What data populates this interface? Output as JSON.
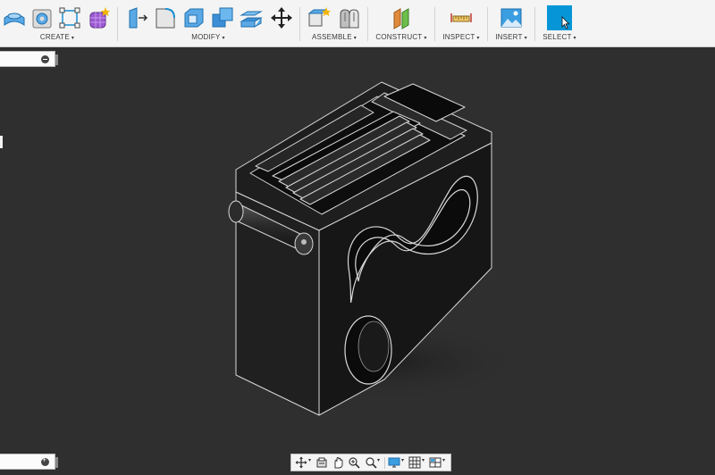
{
  "toolbar": {
    "groups": [
      {
        "id": "create",
        "label": "CREATE"
      },
      {
        "id": "modify",
        "label": "MODIFY"
      },
      {
        "id": "assemble",
        "label": "ASSEMBLE"
      },
      {
        "id": "construct",
        "label": "CONSTRUCT"
      },
      {
        "id": "inspect",
        "label": "INSPECT"
      },
      {
        "id": "insert",
        "label": "INSERT"
      },
      {
        "id": "select",
        "label": "SELECT"
      }
    ],
    "dropdown_glyph": "▾"
  },
  "icons": {
    "create": [
      "extrude-icon",
      "revolve-icon",
      "sketch-icon",
      "form-icon"
    ],
    "modify": [
      "press-pull-icon",
      "fillet-icon",
      "shell-icon",
      "combine-icon",
      "offset-face-icon",
      "move-icon"
    ],
    "assemble": [
      "new-component-icon",
      "joint-icon"
    ],
    "construct": [
      "plane-icon"
    ],
    "inspect": [
      "measure-icon"
    ],
    "insert": [
      "insert-image-icon"
    ],
    "select": [
      "select-cursor-icon"
    ]
  },
  "viewport": {
    "background": "#2f2f2f",
    "model": "3d-printed-box-with-infinity-cutout"
  },
  "panels": {
    "browser": {
      "collapse_icon": "minus-circle-icon"
    },
    "comments": {
      "expand_icon": "plus-circle-icon"
    }
  },
  "navbar": {
    "tools": [
      "orbit-icon",
      "look-at-icon",
      "pan-icon",
      "zoom-window-icon",
      "zoom-icon",
      "display-settings-icon",
      "grid-icon",
      "viewports-icon"
    ]
  },
  "colors": {
    "toolbar_bg": "#f4f4f4",
    "accent_blue": "#1a8fd0",
    "select_button": "#0696d7",
    "model_face": "#1b1b1b",
    "model_edge": "#d8d8d8"
  }
}
